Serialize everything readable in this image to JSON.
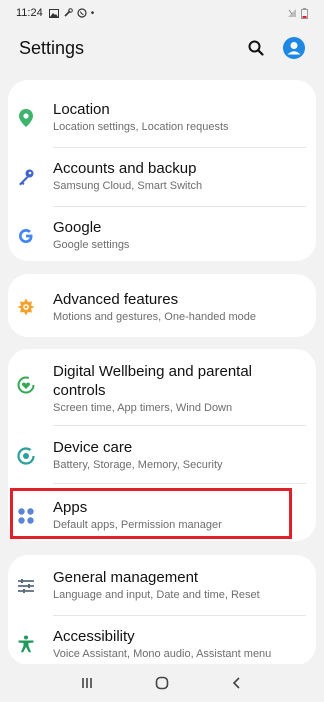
{
  "status_bar": {
    "time": "11:24",
    "dot": "•"
  },
  "header": {
    "title": "Settings"
  },
  "items": {
    "location": {
      "title": "Location",
      "subtitle": "Location settings, Location requests"
    },
    "accounts": {
      "title": "Accounts and backup",
      "subtitle": "Samsung Cloud, Smart Switch"
    },
    "google": {
      "title": "Google",
      "subtitle": "Google settings"
    },
    "advanced": {
      "title": "Advanced features",
      "subtitle": "Motions and gestures, One-handed mode"
    },
    "wellbeing": {
      "title": "Digital Wellbeing and parental controls",
      "subtitle": "Screen time, App timers, Wind Down"
    },
    "device_care": {
      "title": "Device care",
      "subtitle": "Battery, Storage, Memory, Security"
    },
    "apps": {
      "title": "Apps",
      "subtitle": "Default apps, Permission manager"
    },
    "general": {
      "title": "General management",
      "subtitle": "Language and input, Date and time, Reset"
    },
    "accessibility": {
      "title": "Accessibility",
      "subtitle": "Voice Assistant, Mono audio, Assistant menu"
    }
  },
  "colors": {
    "background": "#f2f2f2",
    "card": "#ffffff",
    "location_green": "#3db36b",
    "accounts_blue": "#3f63c9",
    "google_blue": "#4285f4",
    "advanced_orange": "#f3a32b",
    "wellbeing_green": "#34a853",
    "device_care_teal": "#2aa198",
    "apps_blue": "#5b83d6",
    "general_gray": "#5a6b7c",
    "accessibility_green": "#1d9a5c",
    "highlight_red": "#e0202a",
    "profile_blue": "#1e88e5"
  }
}
